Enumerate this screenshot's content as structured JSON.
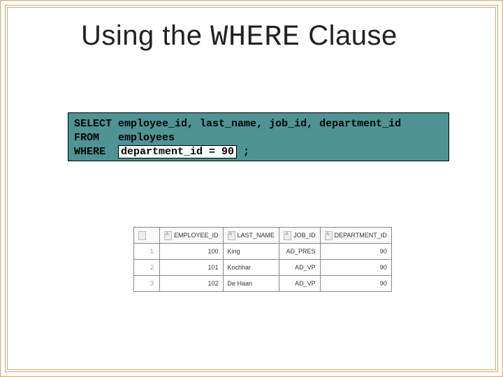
{
  "title": {
    "prefix": "Using the ",
    "mono": "WHERE",
    "suffix": " Clause"
  },
  "sql": {
    "line1_kw": "SELECT",
    "line1_rest": "employee_id, last_name, job_id, department_id",
    "line2_kw": "FROM",
    "line2_rest": "employees",
    "line3_kw": "WHERE",
    "line3_hl": "department_id = 90",
    "line3_tail": ";"
  },
  "result": {
    "headers": [
      "EMPLOYEE_ID",
      "LAST_NAME",
      "JOB_ID",
      "DEPARTMENT_ID"
    ],
    "rows": [
      {
        "n": "1",
        "emp": "100",
        "ln": "King",
        "job": "AD_PRES",
        "dept": "90"
      },
      {
        "n": "2",
        "emp": "101",
        "ln": "Kochhar",
        "job": "AD_VP",
        "dept": "90"
      },
      {
        "n": "3",
        "emp": "102",
        "ln": "De Haan",
        "job": "AD_VP",
        "dept": "90"
      }
    ]
  }
}
